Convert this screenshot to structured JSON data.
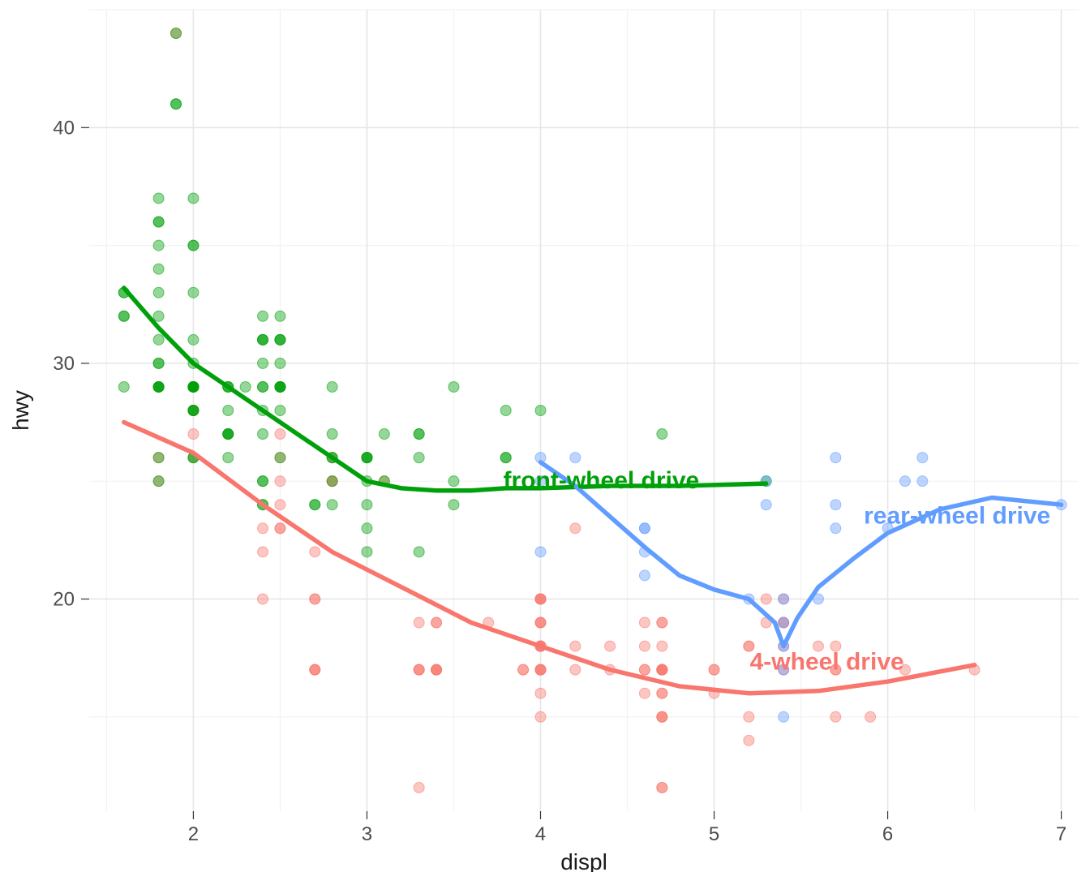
{
  "chart_data": {
    "type": "scatter",
    "xlabel": "displ",
    "ylabel": "hwy",
    "xlim": [
      1.4,
      7.1
    ],
    "ylim": [
      11,
      45
    ],
    "x_ticks": [
      2,
      3,
      4,
      5,
      6,
      7
    ],
    "y_ticks": [
      20,
      30,
      40
    ],
    "colors": {
      "4-wheel drive": "#F8766D",
      "front-wheel drive": "#00A00A",
      "rear-wheel drive": "#619CFF"
    },
    "labels": [
      {
        "text": "front-wheel drive",
        "x": 4.35,
        "y": 24.7,
        "series": "front-wheel drive"
      },
      {
        "text": "rear-wheel drive",
        "x": 6.4,
        "y": 23.2,
        "series": "rear-wheel drive"
      },
      {
        "text": "4-wheel drive",
        "x": 5.65,
        "y": 17.0,
        "series": "4-wheel drive"
      }
    ],
    "series": [
      {
        "name": "4-wheel drive",
        "points": [
          [
            1.8,
            26
          ],
          [
            1.8,
            25
          ],
          [
            2.0,
            28
          ],
          [
            2.0,
            27
          ],
          [
            2.8,
            25
          ],
          [
            2.8,
            25
          ],
          [
            3.1,
            25
          ],
          [
            4.2,
            23
          ],
          [
            2.5,
            27
          ],
          [
            2.5,
            25
          ],
          [
            3.3,
            17
          ],
          [
            3.3,
            19
          ],
          [
            3.3,
            12
          ],
          [
            4.0,
            17
          ],
          [
            3.7,
            19
          ],
          [
            3.9,
            17
          ],
          [
            4.7,
            12
          ],
          [
            4.7,
            17
          ],
          [
            4.7,
            16
          ],
          [
            5.2,
            15
          ],
          [
            5.2,
            14
          ],
          [
            3.9,
            17
          ],
          [
            4.7,
            19
          ],
          [
            4.7,
            19
          ],
          [
            4.7,
            12
          ],
          [
            5.2,
            18
          ],
          [
            5.7,
            17
          ],
          [
            5.9,
            15
          ],
          [
            4.7,
            17
          ],
          [
            4.7,
            17
          ],
          [
            4.7,
            16
          ],
          [
            4.7,
            15
          ],
          [
            4.7,
            17
          ],
          [
            4.7,
            15
          ],
          [
            5.2,
            18
          ],
          [
            4.0,
            19
          ],
          [
            4.0,
            20
          ],
          [
            4.0,
            17
          ],
          [
            4.0,
            19
          ],
          [
            4.6,
            19
          ],
          [
            5.0,
            17
          ],
          [
            4.2,
            17
          ],
          [
            4.4,
            17
          ],
          [
            4.6,
            16
          ],
          [
            5.4,
            17
          ],
          [
            5.4,
            18
          ],
          [
            4.0,
            17
          ],
          [
            4.0,
            19
          ],
          [
            4.6,
            17
          ],
          [
            5.0,
            16
          ],
          [
            5.3,
            20
          ],
          [
            5.3,
            19
          ],
          [
            5.7,
            15
          ],
          [
            6.5,
            17
          ],
          [
            2.4,
            20
          ],
          [
            2.4,
            22
          ],
          [
            2.4,
            23
          ],
          [
            2.5,
            23
          ],
          [
            2.5,
            24
          ],
          [
            2.5,
            26
          ],
          [
            2.5,
            23
          ],
          [
            2.7,
            20
          ],
          [
            2.7,
            20
          ],
          [
            2.7,
            22
          ],
          [
            3.4,
            19
          ],
          [
            3.4,
            17
          ],
          [
            4.0,
            20
          ],
          [
            4.7,
            17
          ],
          [
            4.7,
            15
          ],
          [
            4.7,
            18
          ],
          [
            5.7,
            18
          ],
          [
            6.1,
            17
          ],
          [
            4.0,
            18
          ],
          [
            4.2,
            18
          ],
          [
            4.4,
            18
          ],
          [
            4.6,
            18
          ],
          [
            5.4,
            19
          ],
          [
            5.4,
            19
          ],
          [
            5.4,
            20
          ],
          [
            4.0,
            18
          ],
          [
            4.0,
            18
          ],
          [
            4.6,
            17
          ],
          [
            5.0,
            17
          ],
          [
            3.3,
            17
          ],
          [
            3.3,
            17
          ],
          [
            4.0,
            17
          ],
          [
            5.6,
            18
          ],
          [
            3.4,
            17
          ],
          [
            3.4,
            17
          ],
          [
            4.0,
            20
          ],
          [
            4.0,
            18
          ],
          [
            4.0,
            15
          ],
          [
            4.0,
            16
          ],
          [
            5.7,
            17
          ],
          [
            2.7,
            17
          ],
          [
            2.7,
            17
          ],
          [
            2.7,
            17
          ],
          [
            3.4,
            17
          ],
          [
            3.4,
            19
          ],
          [
            4.0,
            18
          ],
          [
            4.0,
            20
          ],
          [
            2.8,
            26
          ],
          [
            1.9,
            44
          ],
          [
            2.0,
            26
          ]
        ],
        "smooth": [
          [
            1.6,
            27.5
          ],
          [
            2.0,
            26.2
          ],
          [
            2.4,
            24.0
          ],
          [
            2.8,
            22.0
          ],
          [
            3.2,
            20.5
          ],
          [
            3.6,
            19.0
          ],
          [
            4.0,
            18.0
          ],
          [
            4.4,
            17.0
          ],
          [
            4.8,
            16.3
          ],
          [
            5.2,
            16.0
          ],
          [
            5.6,
            16.1
          ],
          [
            6.0,
            16.5
          ],
          [
            6.5,
            17.2
          ]
        ]
      },
      {
        "name": "front-wheel drive",
        "points": [
          [
            1.8,
            29
          ],
          [
            1.8,
            29
          ],
          [
            2.0,
            31
          ],
          [
            2.0,
            30
          ],
          [
            2.8,
            26
          ],
          [
            2.8,
            26
          ],
          [
            3.1,
            27
          ],
          [
            1.8,
            26
          ],
          [
            1.8,
            25
          ],
          [
            2.0,
            28
          ],
          [
            2.0,
            29
          ],
          [
            2.8,
            27
          ],
          [
            2.8,
            25
          ],
          [
            3.1,
            25
          ],
          [
            2.4,
            24
          ],
          [
            3.0,
            24
          ],
          [
            3.3,
            22
          ],
          [
            1.8,
            33
          ],
          [
            1.8,
            32
          ],
          [
            1.8,
            29
          ],
          [
            2.0,
            26
          ],
          [
            2.0,
            29
          ],
          [
            2.0,
            29
          ],
          [
            2.0,
            29
          ],
          [
            2.0,
            28
          ],
          [
            2.7,
            24
          ],
          [
            2.7,
            24
          ],
          [
            2.2,
            27
          ],
          [
            2.2,
            29
          ],
          [
            2.4,
            31
          ],
          [
            2.4,
            32
          ],
          [
            3.0,
            22
          ],
          [
            2.2,
            27
          ],
          [
            2.2,
            27
          ],
          [
            2.4,
            25
          ],
          [
            2.4,
            25
          ],
          [
            3.0,
            26
          ],
          [
            3.0,
            23
          ],
          [
            3.3,
            26
          ],
          [
            1.6,
            33
          ],
          [
            1.6,
            32
          ],
          [
            1.6,
            32
          ],
          [
            1.6,
            29
          ],
          [
            1.8,
            34
          ],
          [
            1.8,
            36
          ],
          [
            1.8,
            36
          ],
          [
            2.0,
            29
          ],
          [
            2.4,
            24
          ],
          [
            2.4,
            27
          ],
          [
            2.5,
            26
          ],
          [
            1.8,
            30
          ],
          [
            2.0,
            33
          ],
          [
            2.0,
            35
          ],
          [
            2.0,
            37
          ],
          [
            2.0,
            35
          ],
          [
            2.2,
            29
          ],
          [
            2.5,
            29
          ],
          [
            2.5,
            31
          ],
          [
            2.5,
            30
          ],
          [
            3.5,
            29
          ],
          [
            3.5,
            24
          ],
          [
            3.0,
            26
          ],
          [
            3.0,
            25
          ],
          [
            3.5,
            25
          ],
          [
            3.3,
            27
          ],
          [
            4.0,
            28
          ],
          [
            3.8,
            26
          ],
          [
            3.8,
            28
          ],
          [
            3.8,
            26
          ],
          [
            5.3,
            25
          ],
          [
            2.2,
            27
          ],
          [
            2.2,
            29
          ],
          [
            2.4,
            28
          ],
          [
            2.4,
            29
          ],
          [
            3.0,
            26
          ],
          [
            3.0,
            26
          ],
          [
            3.3,
            27
          ],
          [
            1.9,
            41
          ],
          [
            2.0,
            29
          ],
          [
            2.0,
            26
          ],
          [
            2.0,
            28
          ],
          [
            2.0,
            29
          ],
          [
            2.5,
            29
          ],
          [
            2.5,
            29
          ],
          [
            2.8,
            29
          ],
          [
            2.8,
            24
          ],
          [
            1.9,
            44
          ],
          [
            1.9,
            41
          ],
          [
            2.0,
            29
          ],
          [
            2.0,
            29
          ],
          [
            2.5,
            29
          ],
          [
            2.5,
            28
          ],
          [
            1.8,
            29
          ],
          [
            1.8,
            29
          ],
          [
            2.0,
            28
          ],
          [
            2.0,
            29
          ],
          [
            1.6,
            33
          ],
          [
            1.8,
            35
          ],
          [
            1.8,
            37
          ],
          [
            1.8,
            31
          ],
          [
            1.8,
            30
          ],
          [
            4.7,
            27
          ],
          [
            2.3,
            29
          ],
          [
            2.4,
            29
          ],
          [
            2.5,
            31
          ],
          [
            2.5,
            32
          ],
          [
            2.5,
            31
          ],
          [
            2.5,
            29
          ],
          [
            2.2,
            26
          ],
          [
            2.2,
            28
          ],
          [
            2.4,
            30
          ],
          [
            2.4,
            31
          ],
          [
            2.4,
            31
          ]
        ],
        "smooth": [
          [
            1.6,
            33.2
          ],
          [
            1.8,
            31.5
          ],
          [
            2.0,
            30.0
          ],
          [
            2.2,
            29.0
          ],
          [
            2.4,
            28.0
          ],
          [
            2.6,
            27.0
          ],
          [
            2.8,
            26.0
          ],
          [
            3.0,
            25.0
          ],
          [
            3.2,
            24.7
          ],
          [
            3.4,
            24.6
          ],
          [
            3.6,
            24.6
          ],
          [
            3.8,
            24.7
          ],
          [
            4.0,
            24.7
          ],
          [
            4.4,
            24.8
          ],
          [
            4.8,
            24.8
          ],
          [
            5.3,
            24.9
          ]
        ]
      },
      {
        "name": "rear-wheel drive",
        "points": [
          [
            4.2,
            26
          ],
          [
            5.3,
            25
          ],
          [
            5.3,
            24
          ],
          [
            5.7,
            24
          ],
          [
            6.0,
            23
          ],
          [
            5.7,
            26
          ],
          [
            5.7,
            23
          ],
          [
            6.2,
            26
          ],
          [
            6.2,
            25
          ],
          [
            7.0,
            24
          ],
          [
            6.1,
            25
          ],
          [
            4.6,
            23
          ],
          [
            5.4,
            20
          ],
          [
            5.4,
            15
          ],
          [
            4.0,
            26
          ],
          [
            4.0,
            22
          ],
          [
            4.6,
            22
          ],
          [
            4.6,
            21
          ],
          [
            4.6,
            23
          ],
          [
            5.4,
            18
          ],
          [
            5.4,
            19
          ],
          [
            5.4,
            17
          ],
          [
            4.0,
            25
          ],
          [
            5.6,
            20
          ],
          [
            5.2,
            20
          ]
        ],
        "smooth": [
          [
            4.0,
            25.8
          ],
          [
            4.2,
            24.8
          ],
          [
            4.4,
            23.5
          ],
          [
            4.6,
            22.2
          ],
          [
            4.8,
            21.0
          ],
          [
            5.0,
            20.4
          ],
          [
            5.2,
            20.0
          ],
          [
            5.35,
            19.0
          ],
          [
            5.4,
            18.0
          ],
          [
            5.48,
            19.2
          ],
          [
            5.6,
            20.5
          ],
          [
            5.8,
            21.7
          ],
          [
            6.0,
            22.8
          ],
          [
            6.3,
            23.8
          ],
          [
            6.6,
            24.3
          ],
          [
            7.0,
            24.0
          ]
        ]
      }
    ]
  }
}
